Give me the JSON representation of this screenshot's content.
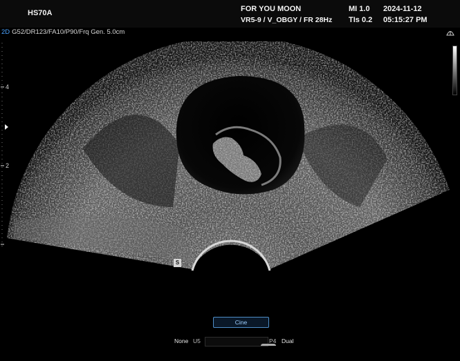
{
  "header": {
    "model": "HS70A",
    "patient": "FOR YOU MOON",
    "probe_preset": "VR5-9 / V_OBGY / FR 28Hz",
    "mi": "MI  1.0",
    "tis": "TIs 0.2",
    "date": "2024-11-12",
    "time": "05:15:27 PM"
  },
  "params": {
    "mode": "2D",
    "settings": "G52/DR123/FA10/P90/Frq Gen. 5.0cm"
  },
  "depth_scale": {
    "labels": [
      "4",
      "2"
    ]
  },
  "markers": {
    "orientation": "S"
  },
  "controls": {
    "cine_label": "Cine",
    "left_label": "None",
    "u_label": "U5",
    "p_label": "P4",
    "right_label": "Dual"
  },
  "icons": [
    "gray-scale-bar",
    "depth-pointer-icon",
    "fan-icon"
  ],
  "colors": {
    "mode_accent": "#4aa3ff",
    "cine_border": "#4f8fc9",
    "background": "#000000"
  }
}
